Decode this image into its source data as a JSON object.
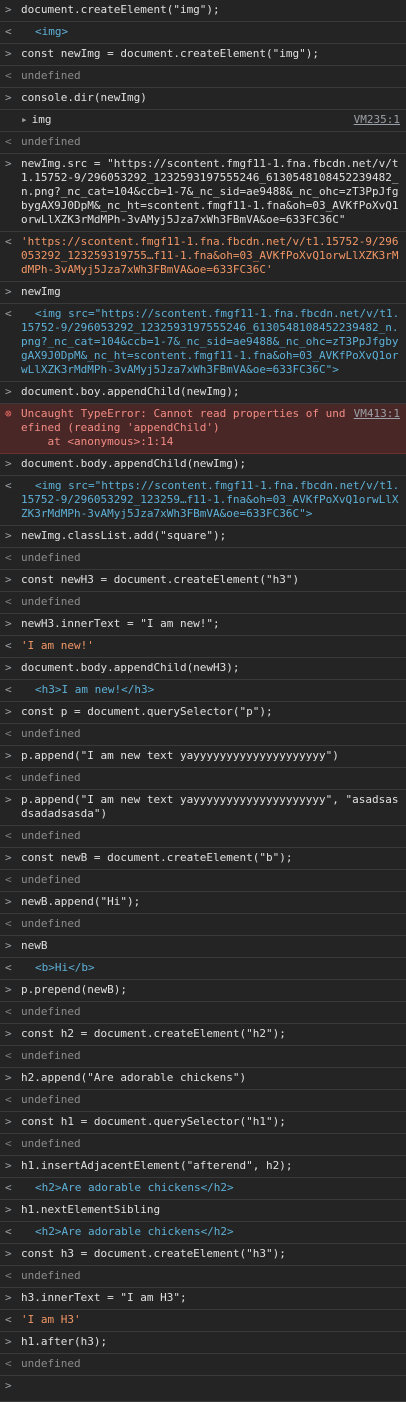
{
  "rows": [
    {
      "kind": "input",
      "text": "document.createElement(\"img\");"
    },
    {
      "kind": "output",
      "text": "<img>"
    },
    {
      "kind": "input",
      "text": "const newImg = document.createElement(\"img\");"
    },
    {
      "kind": "result",
      "text": "undefined"
    },
    {
      "kind": "input",
      "text": "console.dir(newImg)"
    },
    {
      "kind": "log",
      "text": "img",
      "source": "VM235:1"
    },
    {
      "kind": "result",
      "text": "undefined"
    },
    {
      "kind": "input",
      "text": "newImg.src = \"https://scontent.fmgf11-1.fna.fbcdn.net/v/t1.15752-9/296053292_1232593197555246_6130548108452239482_n.png?_nc_cat=104&ccb=1-7&_nc_sid=ae9488&_nc_ohc=zT3PpJfgbygAX9J0DpM&_nc_ht=scontent.fmgf11-1.fna&oh=03_AVKfPoXvQ1orwLlXZK3rMdMPh-3vAMyj5Jza7xWh3FBmVA&oe=633FC36C\""
    },
    {
      "kind": "output",
      "text": "'https://scontent.fmgf11-1.fna.fbcdn.net/v/t1.15752-9/296053292_123259319755…f11-1.fna&oh=03_AVKfPoXvQ1orwLlXZK3rMdMPh-3vAMyj5Jza7xWh3FBmVA&oe=633FC36C'"
    },
    {
      "kind": "input",
      "text": "newImg"
    },
    {
      "kind": "output",
      "text": "<img src=\"https://scontent.fmgf11-1.fna.fbcdn.net/v/t1.15752-9/296053292_1232593197555246_6130548108452239482_n.png?_nc_cat=104&ccb=1-7&_nc_sid=ae9488&_nc_ohc=zT3PpJfgbygAX9J0DpM&_nc_ht=scontent.fmgf11-1.fna&oh=03_AVKfPoXvQ1orwLlXZK3rMdMPh-3vAMyj5Jza7xWh3FBmVA&oe=633FC36C\">"
    },
    {
      "kind": "input",
      "text": "document.boy.appendChild(newImg);"
    },
    {
      "kind": "error",
      "text": "Uncaught TypeError: Cannot read properties of undefined (reading 'appendChild')\n    at <anonymous>:1:14",
      "source": "VM413:1"
    },
    {
      "kind": "input",
      "text": "document.body.appendChild(newImg);"
    },
    {
      "kind": "output",
      "text": "<img src=\"https://scontent.fmgf11-1.fna.fbcdn.net/v/t1.15752-9/296053292_123259…f11-1.fna&oh=03_AVKfPoXvQ1orwLlXZK3rMdMPh-3vAMyj5Jza7xWh3FBmVA&oe=633FC36C\">"
    },
    {
      "kind": "input",
      "text": "newImg.classList.add(\"square\");"
    },
    {
      "kind": "result",
      "text": "undefined"
    },
    {
      "kind": "input",
      "text": "const newH3 = document.createElement(\"h3\")"
    },
    {
      "kind": "result",
      "text": "undefined"
    },
    {
      "kind": "input",
      "text": "newH3.innerText = \"I am new!\";"
    },
    {
      "kind": "output",
      "text": "'I am new!'"
    },
    {
      "kind": "input",
      "text": "document.body.appendChild(newH3);"
    },
    {
      "kind": "output",
      "text": "<h3>I am new!</h3>"
    },
    {
      "kind": "input",
      "text": "const p = document.querySelector(\"p\");"
    },
    {
      "kind": "result",
      "text": "undefined"
    },
    {
      "kind": "input",
      "text": "p.append(\"I am new text yayyyyyyyyyyyyyyyyyyyy\")"
    },
    {
      "kind": "result",
      "text": "undefined"
    },
    {
      "kind": "input",
      "text": "p.append(\"I am new text yayyyyyyyyyyyyyyyyyyyy\", \"asadsasdsadadsasda\")"
    },
    {
      "kind": "result",
      "text": "undefined"
    },
    {
      "kind": "input",
      "text": "const newB = document.createElement(\"b\");"
    },
    {
      "kind": "result",
      "text": "undefined"
    },
    {
      "kind": "input",
      "text": "newB.append(\"Hi\");"
    },
    {
      "kind": "result",
      "text": "undefined"
    },
    {
      "kind": "input",
      "text": "newB"
    },
    {
      "kind": "output",
      "text": "<b>Hi</b>"
    },
    {
      "kind": "input",
      "text": "p.prepend(newB);"
    },
    {
      "kind": "result",
      "text": "undefined"
    },
    {
      "kind": "input",
      "text": "const h2 = document.createElement(\"h2\");"
    },
    {
      "kind": "result",
      "text": "undefined"
    },
    {
      "kind": "input",
      "text": "h2.append(\"Are adorable chickens\")"
    },
    {
      "kind": "result",
      "text": "undefined"
    },
    {
      "kind": "input",
      "text": "const h1 = document.querySelector(\"h1\");"
    },
    {
      "kind": "result",
      "text": "undefined"
    },
    {
      "kind": "input",
      "text": "h1.insertAdjacentElement(\"afterend\", h2);"
    },
    {
      "kind": "output",
      "text": "<h2>Are adorable chickens</h2>"
    },
    {
      "kind": "input",
      "text": "h1.nextElementSibling"
    },
    {
      "kind": "output",
      "text": "<h2>Are adorable chickens</h2>"
    },
    {
      "kind": "input",
      "text": "const h3 = document.createElement(\"h3\");"
    },
    {
      "kind": "result",
      "text": "undefined"
    },
    {
      "kind": "input",
      "text": "h3.innerText = \"I am H3\";"
    },
    {
      "kind": "output",
      "text": "'I am H3'"
    },
    {
      "kind": "input",
      "text": "h1.after(h3);"
    },
    {
      "kind": "result",
      "text": "undefined"
    }
  ],
  "glyphs": {
    "input": ">",
    "result": "<",
    "output": "<",
    "log": "",
    "error": "⊗"
  },
  "colors": {
    "background": "#242424",
    "keyword": "#c594c5",
    "string": "#f29766",
    "tag": "#5db0d7",
    "error_bg": "#4a2727",
    "error_text": "#f28b82"
  }
}
